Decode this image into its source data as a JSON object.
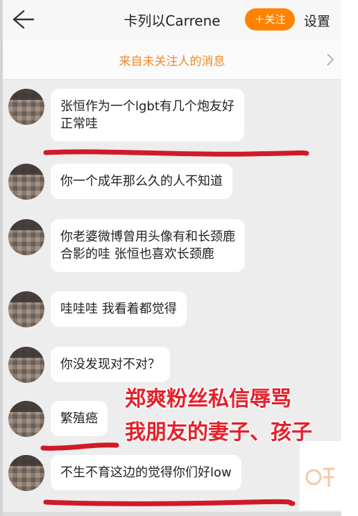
{
  "header": {
    "title": "卡列以Carrene",
    "follow_label": "＋关注",
    "settings_label": "设置"
  },
  "notice": {
    "text": "来自未关注人的消息"
  },
  "messages": [
    {
      "lines": [
        "张恒作为一个lgbt有几个炮友好",
        "正常哇"
      ]
    },
    {
      "lines": [
        "你一个成年那么久的人不知道"
      ]
    },
    {
      "lines": [
        "你老婆微博曾用头像有和长颈鹿",
        "合影的哇 张恒也喜欢长颈鹿"
      ]
    },
    {
      "lines": [
        "哇哇哇 我看着都觉得"
      ]
    },
    {
      "lines": [
        "你没发现对不对？"
      ]
    },
    {
      "lines": [
        "繁殖癌"
      ]
    },
    {
      "lines": [
        "不生不育这边的觉得你们好low"
      ]
    }
  ],
  "overlay": {
    "lines": [
      "郑爽粉丝私信辱骂",
      "我朋友的妻子、孩子"
    ]
  },
  "colors": {
    "accent": "#ff8200",
    "notice_text": "#f08a2a",
    "annotation_red": "#d01a28",
    "background": "#ededed"
  }
}
